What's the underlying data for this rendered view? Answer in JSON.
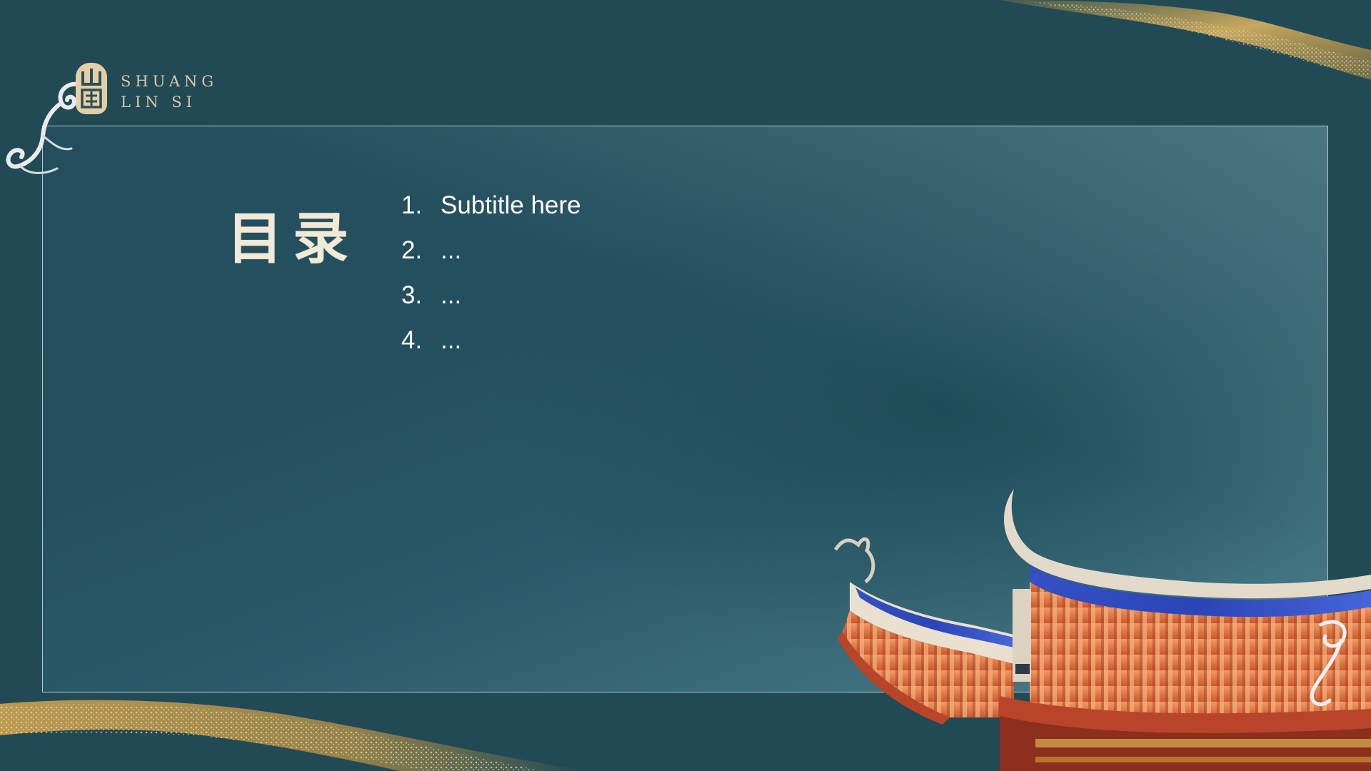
{
  "brand": {
    "seal_text": "山房",
    "line1": "SHUANG",
    "line2": "LIN SI"
  },
  "toc": {
    "title": "目录",
    "items": [
      {
        "num": "1.",
        "label": "Subtitle here"
      },
      {
        "num": "2.",
        "label": "..."
      },
      {
        "num": "3.",
        "label": "..."
      },
      {
        "num": "4.",
        "label": "..."
      }
    ]
  },
  "colors": {
    "background": "#224a55",
    "panel_border": "#b9c9cb",
    "title": "#f2ead8",
    "brand_gold": "#e4cfa6",
    "roof_tile": "#e07a4a",
    "roof_blue": "#2a45b8"
  },
  "decorations": {
    "top_right": "gold-sand-brushstroke",
    "bottom_left": "gold-sand-brushstroke",
    "corner_swirls": "cloud-swirl-icon",
    "temple": "temple-roof-illustration"
  }
}
